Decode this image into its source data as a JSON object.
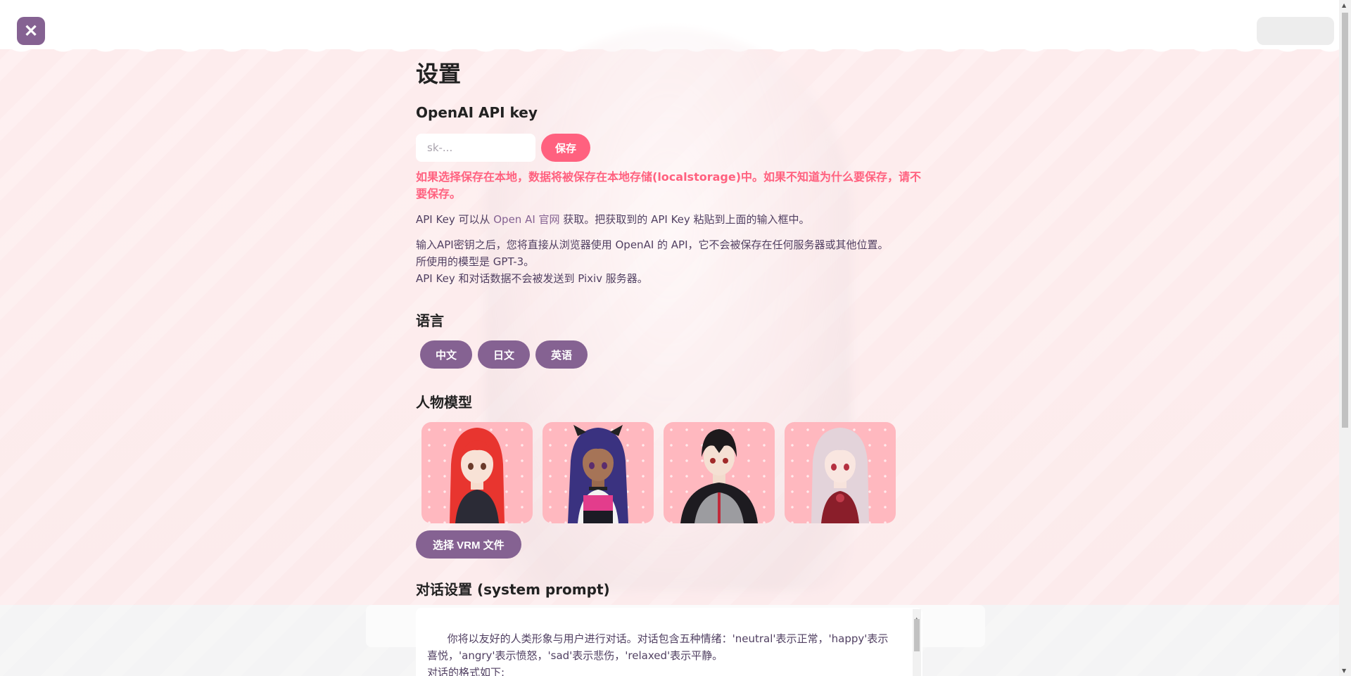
{
  "close_button": {
    "icon": "close-icon",
    "glyph": "✕"
  },
  "settings": {
    "title": "设置",
    "api_key": {
      "heading": "OpenAI API key",
      "input_value": "",
      "placeholder": "sk-...",
      "save_label": "保存",
      "warning": "如果选择保存在本地，数据将被保存在本地存储(localstorage)中。如果不知道为什么要保存，请不要保存。",
      "info_prefix": "API Key 可以从 ",
      "info_link": "Open AI 官网",
      "info_suffix": " 获取。把获取到的 API Key 粘贴到上面的输入框中。",
      "note_line1": "输入API密钥之后，您将直接从浏览器使用 OpenAI 的 API，它不会被保存在任何服务器或其他位置。",
      "note_line2": "所使用的模型是 GPT-3。",
      "note_line3": "API Key 和对话数据不会被发送到 Pixiv 服务器。"
    },
    "language": {
      "heading": "语言",
      "options": [
        "中文",
        "日文",
        "英语"
      ]
    },
    "character_model": {
      "heading": "人物模型",
      "models": [
        {
          "icon": "red-hair-girl-avatar",
          "hair_color": "#e8352f"
        },
        {
          "icon": "purple-hair-girl-avatar",
          "hair_color": "#3a3280"
        },
        {
          "icon": "black-hair-boy-avatar",
          "hair_color": "#1d1a1c"
        },
        {
          "icon": "silver-hair-girl-avatar",
          "hair_color": "#e3d3da"
        }
      ],
      "select_vrm_label": "选择 VRM 文件"
    },
    "system_prompt": {
      "heading": "对话设置 (system prompt)",
      "value": "你将以友好的人类形象与用户进行对话。对话包含五种情绪：'neutral'表示正常，'happy'表示喜悦，'angry'表示愤怒，'sad'表示悲伤，'relaxed'表示平静。\n对话的格式如下:\n[{neutral|happy|angry|sad|relaxed}] {conversation}"
    }
  },
  "colors": {
    "accent_purple": "#856292",
    "accent_pink": "#ff617f",
    "text": "#514062"
  }
}
